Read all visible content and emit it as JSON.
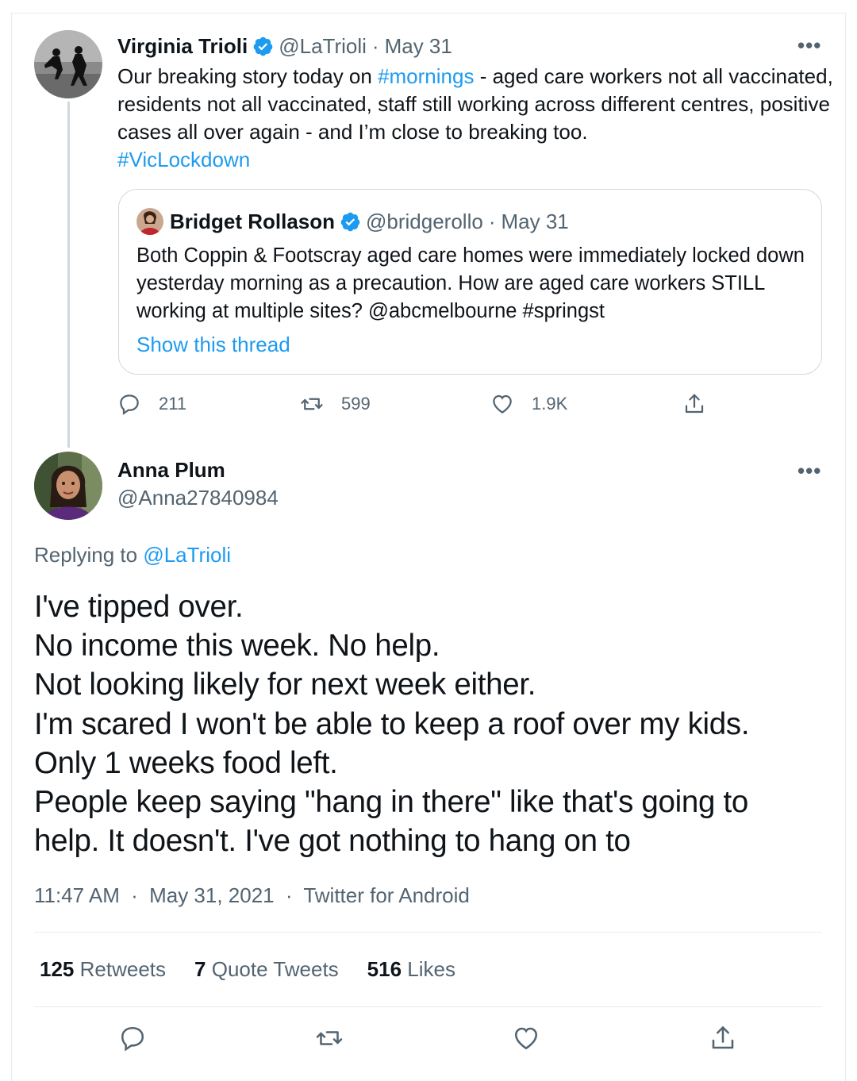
{
  "thread": {
    "original_tweet": {
      "name": "Virginia Trioli",
      "handle": "@LaTrioli",
      "separator": "·",
      "date": "May 31",
      "text_before_link": "Our breaking story today on ",
      "hashtag_mornings": "#mornings",
      "text_after_link": " - aged care workers not all vaccinated, residents not all vaccinated, staff still working across different centres, positive cases all over again - and I’m close to breaking too.",
      "hashtag_viclockdown": "#VicLockdown",
      "more_label": "•••",
      "actions": {
        "replies": "211",
        "retweets": "599",
        "likes": "1.9K"
      }
    },
    "quoted_tweet": {
      "name": "Bridget Rollason",
      "handle": "@bridgerollo",
      "separator": "·",
      "date": "May 31",
      "text": "Both Coppin & Footscray aged care homes were immediately locked down yesterday morning as a precaution. How are aged care workers STILL working at multiple sites? @abcmelbourne #springst",
      "show_thread": "Show this thread"
    },
    "reply_tweet": {
      "name": "Anna Plum",
      "handle": "@Anna27840984",
      "more_label": "•••",
      "replying_to_label": "Replying to ",
      "replying_to_handle": "@LaTrioli",
      "lines": [
        "I've tipped over.",
        "No income this week. No help.",
        "Not looking likely for next week either.",
        "I'm scared I won't be able to keep a roof over my kids.",
        "Only 1 weeks food left.",
        "People keep saying \"hang in there\" like that's going to",
        "help. It doesn't. I've got nothing to hang on to"
      ],
      "time": "11:47 AM",
      "separator": "·",
      "date": "May 31, 2021",
      "source": "Twitter for Android",
      "stats": {
        "retweets_count": "125",
        "retweets_label": "Retweets",
        "quote_count": "7",
        "quote_label": "Quote Tweets",
        "likes_count": "516",
        "likes_label": "Likes"
      }
    }
  },
  "icons": {
    "verified": "verified-badge-icon",
    "reply": "reply-icon",
    "retweet": "retweet-icon",
    "like": "heart-icon",
    "share": "share-icon"
  },
  "colors": {
    "link": "#1d9bf0",
    "muted": "#536471",
    "text": "#0f1419",
    "border": "#cfd9de"
  }
}
